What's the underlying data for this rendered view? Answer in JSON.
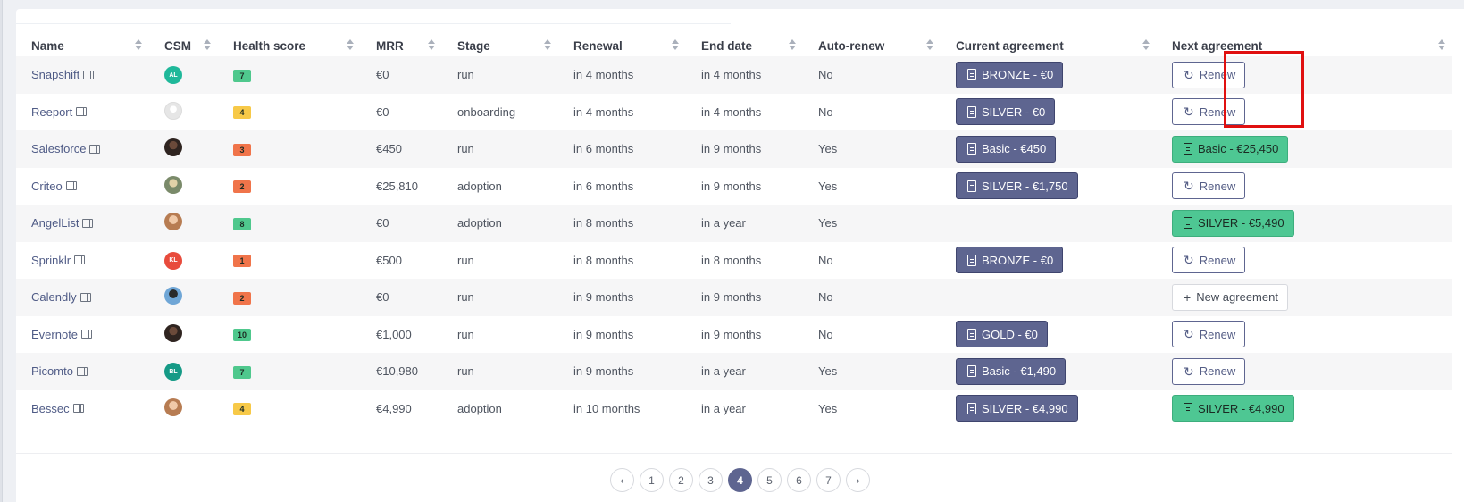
{
  "columns": [
    "Name",
    "CSM",
    "Health score",
    "MRR",
    "Stage",
    "Renewal",
    "End date",
    "Auto-renew",
    "Current agreement",
    "Next agreement"
  ],
  "rows": [
    {
      "name": "Snapshift",
      "csm": {
        "type": "initials",
        "text": "AL",
        "color": "#1fb89a"
      },
      "score": "7",
      "score_color": "#4fc88d",
      "mrr": "€0",
      "stage": "run",
      "renewal": "in 4 months",
      "end_date": "in 4 months",
      "auto_renew": "No",
      "current": "BRONZE - €0",
      "next": {
        "type": "renew",
        "label": "Renew"
      }
    },
    {
      "name": "Reeport",
      "csm": {
        "type": "photo",
        "style": "photo-grey"
      },
      "score": "4",
      "score_color": "#f7c948",
      "mrr": "€0",
      "stage": "onboarding",
      "renewal": "in 4 months",
      "end_date": "in 4 months",
      "auto_renew": "No",
      "current": "SILVER - €0",
      "next": {
        "type": "renew",
        "label": "Renew"
      }
    },
    {
      "name": "Salesforce",
      "csm": {
        "type": "photo",
        "style": "photo-dark"
      },
      "score": "3",
      "score_color": "#f0744a",
      "mrr": "€450",
      "stage": "run",
      "renewal": "in 6 months",
      "end_date": "in 9 months",
      "auto_renew": "Yes",
      "current": "Basic - €450",
      "next": {
        "type": "agreement",
        "label": "Basic - €25,450"
      }
    },
    {
      "name": "Criteo",
      "csm": {
        "type": "photo",
        "style": "photo-olive"
      },
      "score": "2",
      "score_color": "#f0744a",
      "mrr": "€25,810",
      "stage": "adoption",
      "renewal": "in 6 months",
      "end_date": "in 9 months",
      "auto_renew": "Yes",
      "current": "SILVER - €1,750",
      "next": {
        "type": "renew",
        "label": "Renew"
      }
    },
    {
      "name": "AngelList",
      "csm": {
        "type": "photo",
        "style": "photo-light"
      },
      "score": "8",
      "score_color": "#4fc88d",
      "mrr": "€0",
      "stage": "adoption",
      "renewal": "in 8 months",
      "end_date": "in a year",
      "auto_renew": "Yes",
      "current": "",
      "next": {
        "type": "agreement",
        "label": "SILVER - €5,490"
      }
    },
    {
      "name": "Sprinklr",
      "csm": {
        "type": "initials",
        "text": "KL",
        "color": "#e84b3c"
      },
      "score": "1",
      "score_color": "#f0744a",
      "mrr": "€500",
      "stage": "run",
      "renewal": "in 8 months",
      "end_date": "in 8 months",
      "auto_renew": "No",
      "current": "BRONZE - €0",
      "next": {
        "type": "renew",
        "label": "Renew"
      }
    },
    {
      "name": "Calendly",
      "csm": {
        "type": "photo",
        "style": "photo-blue"
      },
      "score": "2",
      "score_color": "#f0744a",
      "mrr": "€0",
      "stage": "run",
      "renewal": "in 9 months",
      "end_date": "in 9 months",
      "auto_renew": "No",
      "current": "",
      "next": {
        "type": "new",
        "label": "New agreement"
      }
    },
    {
      "name": "Evernote",
      "csm": {
        "type": "photo",
        "style": "photo-dark"
      },
      "score": "10",
      "score_color": "#4fc88d",
      "mrr": "€1,000",
      "stage": "run",
      "renewal": "in 9 months",
      "end_date": "in 9 months",
      "auto_renew": "No",
      "current": "GOLD - €0",
      "next": {
        "type": "renew",
        "label": "Renew"
      }
    },
    {
      "name": "Picomto",
      "csm": {
        "type": "initials",
        "text": "BL",
        "color": "#159a86"
      },
      "score": "7",
      "score_color": "#4fc88d",
      "mrr": "€10,980",
      "stage": "run",
      "renewal": "in 9 months",
      "end_date": "in a year",
      "auto_renew": "Yes",
      "current": "Basic - €1,490",
      "next": {
        "type": "renew",
        "label": "Renew"
      }
    },
    {
      "name": "Bessec",
      "csm": {
        "type": "photo",
        "style": "photo-light"
      },
      "score": "4",
      "score_color": "#f7c948",
      "mrr": "€4,990",
      "stage": "adoption",
      "renewal": "in 10 months",
      "end_date": "in a year",
      "auto_renew": "Yes",
      "current": "SILVER - €4,990",
      "next": {
        "type": "agreement",
        "label": "SILVER - €4,990"
      }
    }
  ],
  "pagination": {
    "prev": "‹",
    "next": "›",
    "pages": [
      "1",
      "2",
      "3",
      "4",
      "5",
      "6",
      "7"
    ],
    "active": "4"
  },
  "colors": {
    "accent": "#5e6590",
    "green": "#4ec793",
    "highlight": "#e01010"
  }
}
